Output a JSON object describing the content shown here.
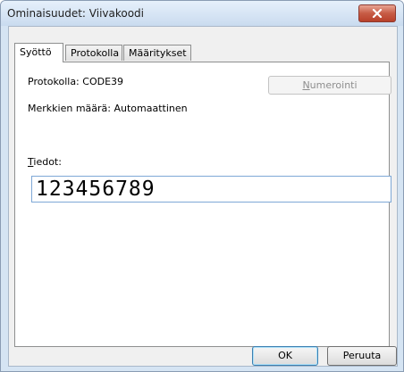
{
  "window": {
    "title": "Ominaisuudet: Viivakoodi",
    "close_symbol": "✕",
    "close_color": "#c75b45"
  },
  "tabs": [
    {
      "label": "Syöttö",
      "active": true
    },
    {
      "label": "Protokolla",
      "active": false
    },
    {
      "label": "Määritykset",
      "active": false
    }
  ],
  "panel": {
    "protocol_text": "Protokolla: CODE39",
    "char_count_text": "Merkkien määrä: Automaattinen",
    "numbering_button": {
      "mnemonic": "N",
      "rest": "umerointi",
      "enabled": false
    },
    "data_label": {
      "mnemonic": "T",
      "rest": "iedot:"
    },
    "data_value": "123456789"
  },
  "buttons": {
    "ok": "OK",
    "cancel": "Peruuta"
  }
}
